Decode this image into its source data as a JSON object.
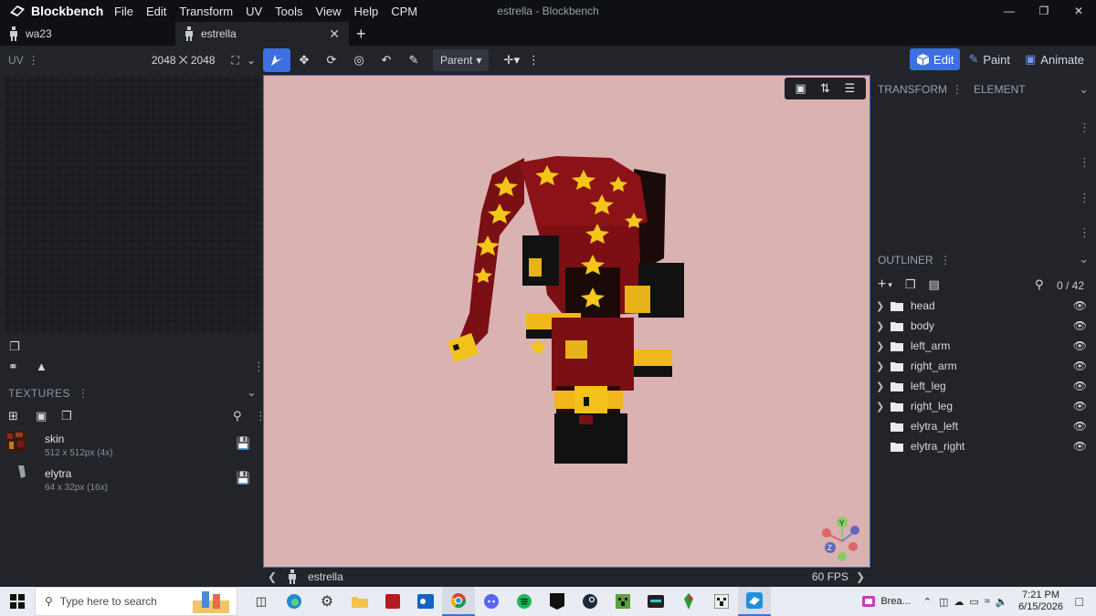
{
  "app": {
    "name": "Blockbench",
    "window_title": "estrella - Blockbench",
    "menu": [
      "File",
      "Edit",
      "Transform",
      "UV",
      "Tools",
      "View",
      "Help",
      "CPM"
    ]
  },
  "tabs": [
    {
      "label": "wa23",
      "active": false
    },
    {
      "label": "estrella",
      "active": true
    }
  ],
  "toolbar": {
    "uv_label": "UV",
    "uv_resolution": "2048 ⨉ 2048",
    "pivot_dropdown": "Parent"
  },
  "modes": [
    {
      "label": "Edit",
      "active": true
    },
    {
      "label": "Paint",
      "active": false
    },
    {
      "label": "Animate",
      "active": false
    }
  ],
  "textures": {
    "header": "TEXTURES",
    "items": [
      {
        "name": "skin",
        "size": "512 x 512px (4x)"
      },
      {
        "name": "elytra",
        "size": "64 x 32px (16x)"
      }
    ]
  },
  "right_panel": {
    "tabs": [
      "TRANSFORM",
      "ELEMENT"
    ],
    "outliner_header": "OUTLINER",
    "count": "0 / 42",
    "groups": [
      {
        "name": "head",
        "has_children": true
      },
      {
        "name": "body",
        "has_children": true
      },
      {
        "name": "left_arm",
        "has_children": true
      },
      {
        "name": "right_arm",
        "has_children": true
      },
      {
        "name": "left_leg",
        "has_children": true
      },
      {
        "name": "right_leg",
        "has_children": true
      },
      {
        "name": "elytra_left",
        "has_children": false
      },
      {
        "name": "elytra_right",
        "has_children": false
      }
    ]
  },
  "status": {
    "model_name": "estrella",
    "fps": "60 FPS"
  },
  "colors": {
    "accent": "#3c6fe0",
    "viewport_bg": "#dbb2b2",
    "panel_bg": "#22242a",
    "model_red": "#7a0f14",
    "model_star": "#f4c21a"
  },
  "taskbar": {
    "search_placeholder": "Type here to search",
    "active_app_label": "Brea...",
    "time": "7:21 PM",
    "date": "6/15/2026"
  }
}
